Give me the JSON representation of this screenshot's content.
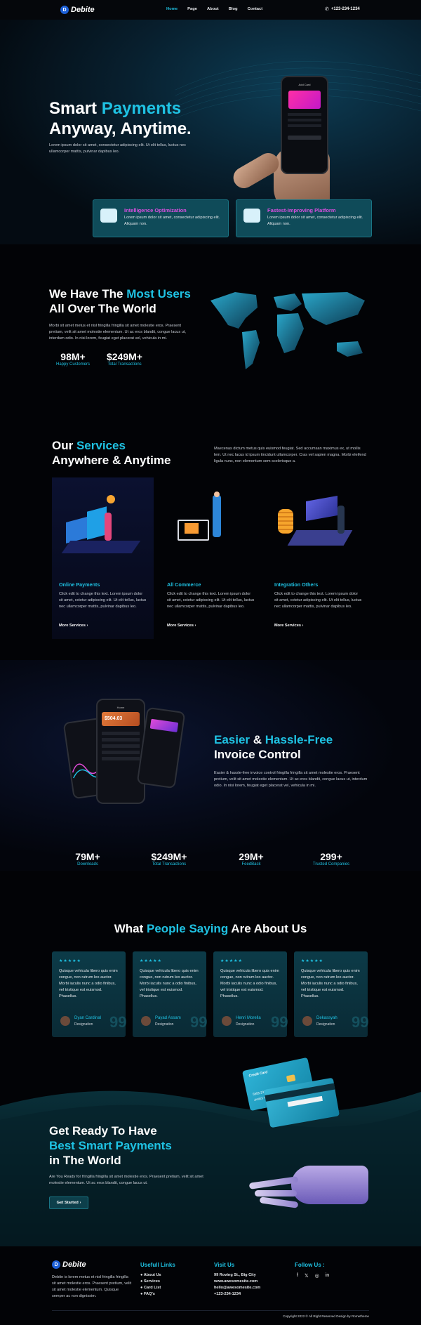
{
  "header": {
    "logo_letter": "D",
    "brand": "Debite",
    "nav": [
      "Home",
      "Page",
      "About",
      "Blog",
      "Contact"
    ],
    "phone": "+123-234-1234"
  },
  "hero": {
    "title_1": "Smart ",
    "title_1_accent": "Payments",
    "title_2": "Anyway, Anytime.",
    "desc": "Lorem ipsum dolor sit amet, consectetur adipiscing elit. Ut elit tellus, luctus nec ullamcorper mattis, pulvinar dapibus leo.",
    "phone_header": "Add Card"
  },
  "features": [
    {
      "title": "Intelligence Optimization",
      "desc": "Lorem ipsum dolor sit amet, consectetur adipiscing elit. Aliquam non."
    },
    {
      "title": "Fastest-Improving Platform",
      "desc": "Lorem ipsum dolor sit amet, consectetur adipiscing elit. Aliquam non."
    }
  ],
  "users": {
    "title_1": "We Have The ",
    "title_accent": "Most Users",
    "title_2": "All Over The World",
    "desc": "Morbi sit amet metus et nisl fringilla fringilla sit amet molestie eros. Praesent pretium, velit sit amet molestie elementum.  Ut ac eros blandit, congue lacus ut, interdum odio. In nisi lorem, feugiat eget placerat vel, vehicula in mi.",
    "stats": [
      {
        "num": "98M+",
        "label": "Happy Customers"
      },
      {
        "num": "$249M+",
        "label": "Total Transactions"
      }
    ]
  },
  "services": {
    "title_1": "Our ",
    "title_accent": "Services",
    "title_2": "Anywhere & Anytime",
    "desc": "Maecenas dictum metus quis euismod feugiat. Sed accumsan maximus ex, ut mollis lem. Ut nec lacus id ipsum tincidunt ullamcorper. Cras vel sapien magna. Morbi eleifend ligula nunc, non elementum sem scelerisque a.",
    "items": [
      {
        "title": "Online Payments",
        "desc": "Click edit to change this text. Lorem ipsum dolor sit amet, cctetur adipiscing elit. Ut elit tellus, luctus nec ullamcorper mattis, pulvinar dapibus leo.",
        "link": "More Services"
      },
      {
        "title": "All Commerce",
        "desc": "Click edit to change this text. Lorem ipsum dolor sit amet, cctetur adipiscing elit. Ut elit tellus, luctus nec ullamcorper mattis, pulvinar dapibus leo.",
        "link": "More Services"
      },
      {
        "title": "Integration Others",
        "desc": "Click edit to change this text. Lorem ipsum dolor sit amet, cctetur adipiscing elit. Ut elit tellus, luctus nec ullamcorper mattis, pulvinar dapibus leo.",
        "link": "More Services"
      }
    ]
  },
  "invoice": {
    "title_accent_1": "Easier",
    "title_mid": " & ",
    "title_accent_2": "Hassle-Free",
    "title_2": "Invoice Control",
    "desc": "Easier & hassle-free invoice control fringilla fringilla sit amet molestie eros. Praesent pretium, velit sit amet molestie elementum.  Ut ac eros blandit, congue lacus ut, interdum odio. In nisi lorem, feugiat eget placerat vel, vehicula in mi.",
    "phone_balance": "$504.03",
    "phone_label": "Home"
  },
  "counters": [
    {
      "num": "79M+",
      "label": "Downloads"
    },
    {
      "num": "$249M+",
      "label": "Total Transactions"
    },
    {
      "num": "29M+",
      "label": "FeedBack"
    },
    {
      "num": "299+",
      "label": "Trusted Companies"
    }
  ],
  "testimonials": {
    "title_1": "What ",
    "title_accent": "People Saying",
    "title_2": " Are About Us",
    "stars": "★★★★★",
    "items": [
      {
        "text": "Quisque vehicula libero quis enim congue, non rutrum leo auctor. Morbi iaculis nunc a odio finibus, vel tristique est euismod. Phasellus.",
        "name": "Dyan Cardinal",
        "role": "Designation"
      },
      {
        "text": "Quisque vehicula libero quis enim congue, non rutrum leo auctor. Morbi iaculis nunc a odio finibus, vel tristique est euismod. Phasellus.",
        "name": "Payad Assam",
        "role": "Designation"
      },
      {
        "text": "Quisque vehicula libero quis enim congue, non rutrum leo auctor. Morbi iaculis nunc a odio finibus, vel tristique est euismod. Phasellus.",
        "name": "Henri Morella",
        "role": "Designation"
      },
      {
        "text": "Quisque vehicula libero quis enim congue, non rutrum leo auctor. Morbi iaculis nunc a odio finibus, vel tristique est euismod. Phasellus.",
        "name": "Dekassyah",
        "role": "Designation"
      }
    ]
  },
  "cta": {
    "title_1": "Get Ready To Have",
    "title_accent": "Best Smart Payments",
    "title_2": "in The World",
    "desc": "Are You Ready for fringilla fringilla sit amet molestie eros. Praesent pretium, velit sit amet molestie elementum.  Ut ac eros blandit, congue lacus ut.",
    "button": "Get Started",
    "card_label": "Credit Card",
    "card_name": "JAMES THOMAS",
    "card_number": "5555 2315 3151 1312"
  },
  "footer": {
    "desc": "Debite is lorem metus et nisl fringilla fringilla sit amet molestie eros. Praesent pretium, velit sit amet molestie elementum. Quisque semper ac non dignissim.",
    "links_title": "Usefull Links",
    "links": [
      "About Us",
      "Services",
      "Card List",
      "FAQ's"
    ],
    "visit_title": "Visit Us",
    "visit": [
      "99 Roving St., Big City",
      "www.awesomesite.com",
      "hello@awesomesite.com",
      "+123-234-1234"
    ],
    "follow_title": "Follow Us :",
    "social": [
      "f",
      "𝕏",
      "◎",
      "in"
    ],
    "copyright": "Copyright 2022 © All Right Reserved Design by Rometheme"
  },
  "colors": {
    "accent": "#1fc2e3",
    "pink": "#d94fe0",
    "card": "#0f4b59",
    "bg": "#020306"
  }
}
